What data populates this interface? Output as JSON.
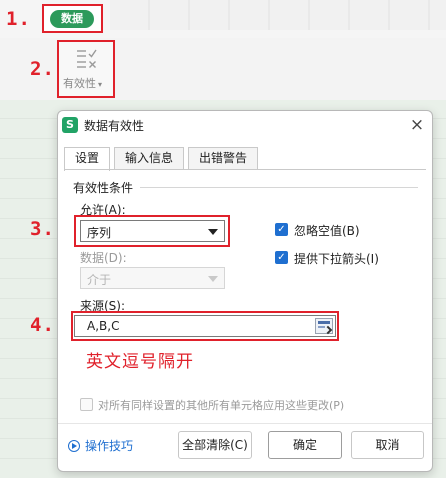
{
  "ribbon": {
    "data_tab_label": "数据",
    "validity_label": "有效性"
  },
  "steps": [
    "1.",
    "2.",
    "3.",
    "4."
  ],
  "dialog": {
    "title": "数据有效性",
    "tabs": [
      "设置",
      "输入信息",
      "出错警告"
    ],
    "section_title": "有效性条件",
    "allow_label": "允许(A):",
    "allow_value": "序列",
    "data_label": "数据(D):",
    "data_value": "介于",
    "ignore_blank_label": "忽略空值(B)",
    "ignore_blank_checked": true,
    "dropdown_label": "提供下拉箭头(I)",
    "dropdown_checked": true,
    "source_label": "来源(S):",
    "source_value": "A,B,C",
    "annotation": "英文逗号隔开",
    "apply_all_label": "对所有同样设置的其他所有单元格应用这些更改(P)",
    "apply_all_checked": false,
    "tips_label": "操作技巧",
    "clear_all_button": "全部清除(C)",
    "ok_button": "确定",
    "cancel_button": "取消"
  },
  "colors": {
    "accent_red": "#e0212b",
    "data_tab_green": "#2c9a5b",
    "checkbox_blue": "#1f6fd0"
  }
}
